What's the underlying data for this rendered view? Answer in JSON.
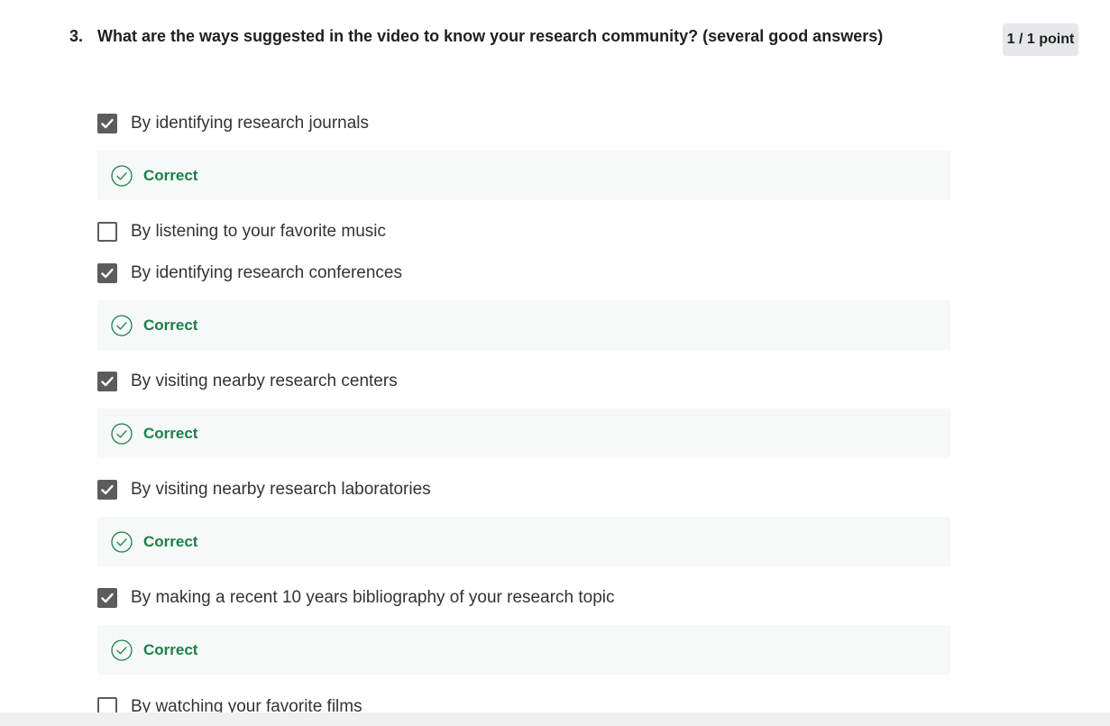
{
  "question": {
    "number": "3.",
    "text": "What are the ways suggested in the video to know your research community? (several good answers)",
    "points": "1 / 1 point"
  },
  "options": [
    {
      "label": "By identifying research journals",
      "checked": true,
      "feedback": "Correct"
    },
    {
      "label": "By listening to your favorite music",
      "checked": false
    },
    {
      "label": "By identifying research conferences",
      "checked": true,
      "feedback": "Correct"
    },
    {
      "label": "By visiting nearby research centers",
      "checked": true,
      "feedback": "Correct"
    },
    {
      "label": "By visiting nearby research laboratories",
      "checked": true,
      "feedback": "Correct"
    },
    {
      "label": "By making a recent 10 years bibliography of your research topic",
      "checked": true,
      "feedback": "Correct"
    },
    {
      "label": "By watching your favorite films",
      "checked": false
    }
  ],
  "colors": {
    "correct": "#1e7e4a",
    "feedback_bg": "#f5f9f8",
    "checkbox": "#5c5c5c"
  },
  "icons": {
    "checked": "checkmark-icon",
    "feedback": "check-circle-icon"
  }
}
